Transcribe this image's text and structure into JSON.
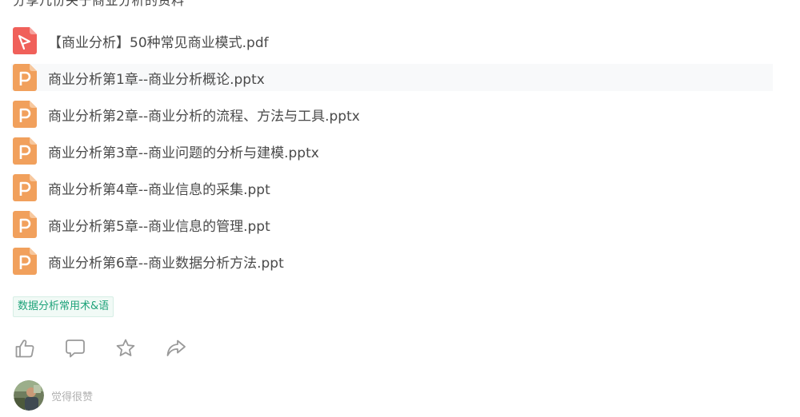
{
  "post": {
    "top_text": "分享几份关于商业分析的资料"
  },
  "attachments": [
    {
      "name": "【商业分析】50种常见商业模式.pdf",
      "type": "pdf",
      "icon": "pdf-file-icon"
    },
    {
      "name": "商业分析第1章--商业分析概论.pptx",
      "type": "pptx",
      "icon": "ppt-file-icon"
    },
    {
      "name": "商业分析第2章--商业分析的流程、方法与工具.pptx",
      "type": "pptx",
      "icon": "ppt-file-icon"
    },
    {
      "name": "商业分析第3章--商业问题的分析与建模.pptx",
      "type": "pptx",
      "icon": "ppt-file-icon"
    },
    {
      "name": "商业分析第4章--商业信息的采集.ppt",
      "type": "ppt",
      "icon": "ppt-file-icon"
    },
    {
      "name": "商业分析第5章--商业信息的管理.ppt",
      "type": "ppt",
      "icon": "ppt-file-icon"
    },
    {
      "name": "商业分析第6章--商业数据分析方法.ppt",
      "type": "ppt",
      "icon": "ppt-file-icon"
    }
  ],
  "tag": {
    "label": "数据分析常用术&语"
  },
  "actions": [
    {
      "name": "like",
      "icon": "thumbs-up-icon"
    },
    {
      "name": "comment",
      "icon": "comment-icon"
    },
    {
      "name": "favorite",
      "icon": "star-icon"
    },
    {
      "name": "share",
      "icon": "share-icon"
    }
  ],
  "liked_by": {
    "text": "觉得很赞"
  },
  "colors": {
    "pdf_icon": "#f0605a",
    "ppt_icon": "#f1a05c",
    "tag_text": "#1fa37a",
    "tag_bg": "#f1faf6",
    "action_icon": "#9a9a9a",
    "row_hover": "#f8f9fa"
  }
}
